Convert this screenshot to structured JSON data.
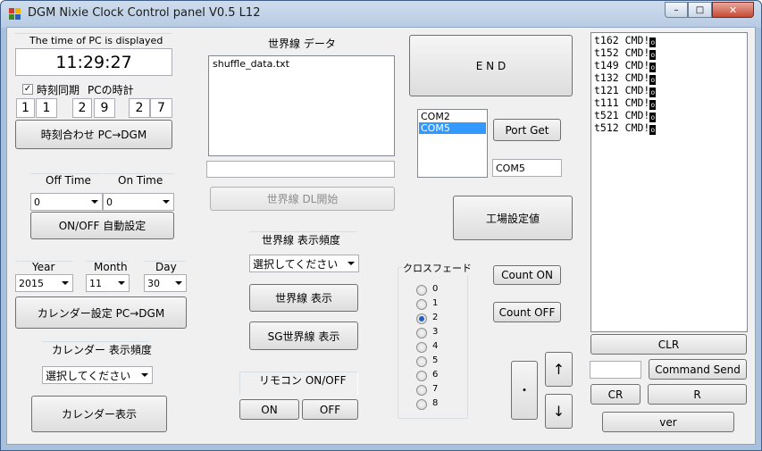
{
  "window": {
    "title": "DGM Nixie Clock  Control panel  V0.5 L12",
    "controls": {
      "minimize": "–",
      "maximize": "□",
      "close": "✕"
    }
  },
  "pc_time": {
    "header": "The time of PC is displayed",
    "time": "11:29:27",
    "sync_checkbox_label": "時刻同期",
    "sync_checked": true,
    "pc_clock_label": "PCの時計",
    "digits": [
      "1",
      "1",
      "2",
      "9",
      "2",
      "7"
    ],
    "set_button": "時刻合わせ  PC→DGM"
  },
  "onoff": {
    "off_label": "Off Time",
    "on_label": "On Time",
    "off_value": "0",
    "on_value": "0",
    "auto_button": "ON/OFF 自動設定"
  },
  "calendar": {
    "year_label": "Year",
    "month_label": "Month",
    "day_label": "Day",
    "year_value": "2015",
    "month_value": "11",
    "day_value": "30",
    "set_button": "カレンダー設定  PC→DGM",
    "freq_label": "カレンダー  表示頻度",
    "freq_value": "選択してください",
    "show_button": "カレンダー表示"
  },
  "worldline": {
    "header": "世界線  データ",
    "files": [
      "shuffle_data.txt"
    ],
    "path_value": "",
    "dl_button": "世界線  DL開始",
    "freq_label": "世界線  表示頻度",
    "freq_value": "選択してください",
    "show_button": "世界線  表示",
    "sg_button": "SG世界線  表示"
  },
  "remote": {
    "label": "リモコン  ON/OFF",
    "on_button": "ON",
    "off_button": "OFF"
  },
  "end_button": "E N D",
  "port": {
    "list": [
      "COM2",
      "COM5"
    ],
    "selected": "COM5",
    "get_button": "Port Get",
    "current": "COM5"
  },
  "factory_button": "工場設定値",
  "crossfade": {
    "label": "クロスフェード",
    "options": [
      "0",
      "1",
      "2",
      "3",
      "4",
      "5",
      "6",
      "7",
      "8"
    ],
    "selected_index": 2
  },
  "count": {
    "on_button": "Count  ON",
    "off_button": "Count  OFF"
  },
  "nav": {
    "dot": "・",
    "up": "↑",
    "down": "↓"
  },
  "console": {
    "lines": [
      "t162 CMD!",
      "t152 CMD!",
      "t149 CMD!",
      "t132 CMD!",
      "t121 CMD!",
      "t111 CMD!",
      "t521 CMD!",
      "t512 CMD!"
    ],
    "cursor_char": "o",
    "clr_button": "CLR",
    "command_value": "",
    "send_button": "Command Send",
    "cr_button": "CR",
    "r_button": "R",
    "ver_button": "ver"
  },
  "colors": {
    "selection": "#3399ff",
    "frame": "#a9c0dc",
    "client": "#f0f0f0"
  }
}
